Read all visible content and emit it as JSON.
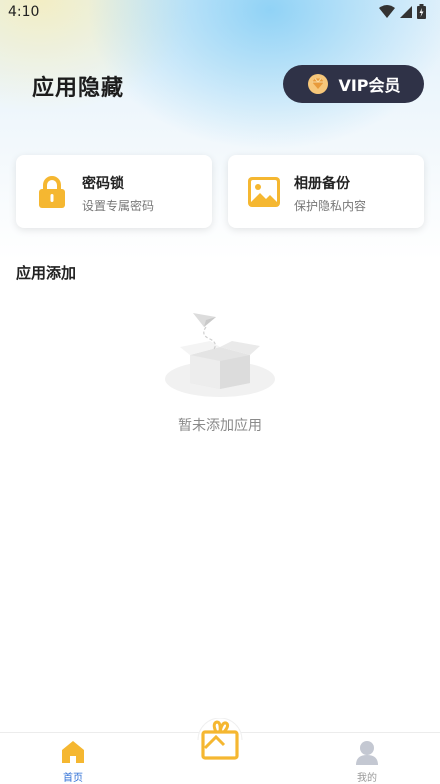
{
  "status_bar": {
    "time": "4:10"
  },
  "header": {
    "title": "应用隐藏",
    "vip_label": "VIP会员"
  },
  "cards": [
    {
      "title": "密码锁",
      "subtitle": "设置专属密码",
      "icon": "lock-icon"
    },
    {
      "title": "相册备份",
      "subtitle": "保护隐私内容",
      "icon": "image-icon"
    }
  ],
  "section": {
    "title": "应用添加",
    "empty_text": "暂未添加应用"
  },
  "bottom_nav": {
    "home_label": "首页",
    "mine_label": "我的",
    "center_icon": "gift-icon"
  },
  "colors": {
    "accent": "#f5b731",
    "vip_bg": "#2f3247",
    "active_nav": "#2f6fd6"
  }
}
